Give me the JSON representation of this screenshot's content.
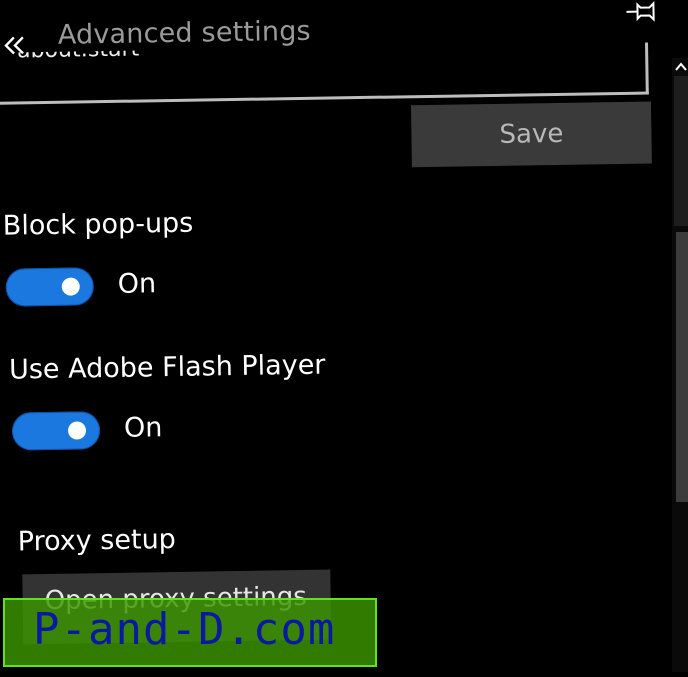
{
  "header": {
    "title": "Advanced settings",
    "back_icon": "double-chevron-left-icon",
    "pin_icon": "pin-icon"
  },
  "home_page_field": {
    "value": "about:start"
  },
  "save_button": {
    "label": "Save"
  },
  "settings": [
    {
      "label": "Block pop-ups",
      "state": "On",
      "enabled": true
    },
    {
      "label": "Use Adobe Flash Player",
      "state": "On",
      "enabled": true
    }
  ],
  "proxy": {
    "label": "Proxy setup",
    "button_label": "Open proxy settings"
  },
  "scrollbar": {
    "up_icon": "chevron-up-icon"
  },
  "watermark": {
    "text": "P-and-D.com"
  },
  "colors": {
    "accent": "#1b78de",
    "background": "#000000",
    "button": "#3a3a3a",
    "watermark_bg": "#3c9600",
    "watermark_text": "#0a1aa0"
  }
}
